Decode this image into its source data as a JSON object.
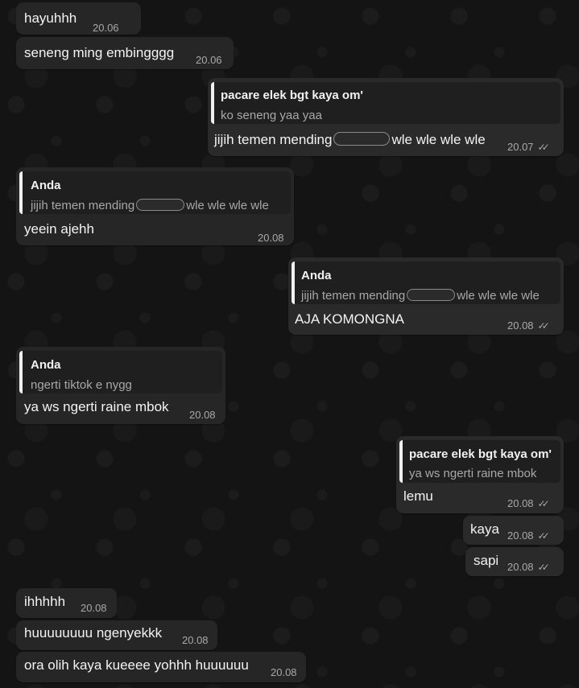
{
  "colors": {
    "wallpaper": "#141414",
    "bubble_in": "#262626",
    "bubble_out": "#2a2a2a",
    "quote_bar": "#f0f0f0",
    "meta_text": "#a9a9a9"
  },
  "messages": [
    {
      "id": "m1",
      "direction": "in",
      "text": "hayuhhh",
      "time": "20.06"
    },
    {
      "id": "m2",
      "direction": "in",
      "text": "seneng ming embingggg",
      "time": "20.06"
    },
    {
      "id": "m3",
      "direction": "out",
      "reply_to": {
        "author": "pacare elek bgt kaya om'",
        "text": "ko seneng yaa yaa"
      },
      "text_before": "jijih temen mending",
      "text_after": "wle wle wle wle",
      "time": "20.07",
      "ticks_icon": "double-check-icon"
    },
    {
      "id": "m4",
      "direction": "in",
      "reply_to": {
        "author": "Anda",
        "text_before": "jijih temen mending",
        "text_after": "wle wle wle wle"
      },
      "text": "yeein ajehh",
      "time": "20.08"
    },
    {
      "id": "m5",
      "direction": "out",
      "reply_to": {
        "author": "Anda",
        "text_before": "jijih temen mending",
        "text_after": "wle wle wle wle"
      },
      "text": "AJA KOMONGNA",
      "time": "20.08",
      "ticks_icon": "double-check-icon"
    },
    {
      "id": "m6",
      "direction": "in",
      "reply_to": {
        "author": "Anda",
        "text": "ngerti tiktok e nygg"
      },
      "text": "ya ws ngerti raine mbok",
      "time": "20.08"
    },
    {
      "id": "m7",
      "direction": "out",
      "reply_to": {
        "author": "pacare elek bgt kaya om'",
        "text": "ya ws ngerti raine mbok"
      },
      "text": "lemu",
      "time": "20.08",
      "ticks_icon": "double-check-icon"
    },
    {
      "id": "m8",
      "direction": "out",
      "text": "kaya",
      "time": "20.08",
      "ticks_icon": "double-check-icon"
    },
    {
      "id": "m9",
      "direction": "out",
      "text": "sapi",
      "time": "20.08",
      "ticks_icon": "double-check-icon"
    },
    {
      "id": "m10",
      "direction": "in",
      "text": "ihhhhh",
      "time": "20.08"
    },
    {
      "id": "m11",
      "direction": "in",
      "text": "huuuuuuuu ngenyekkk",
      "time": "20.08"
    },
    {
      "id": "m12",
      "direction": "in",
      "text": "ora olih kaya kueeee yohhh huuuuuu",
      "time": "20.08"
    }
  ]
}
